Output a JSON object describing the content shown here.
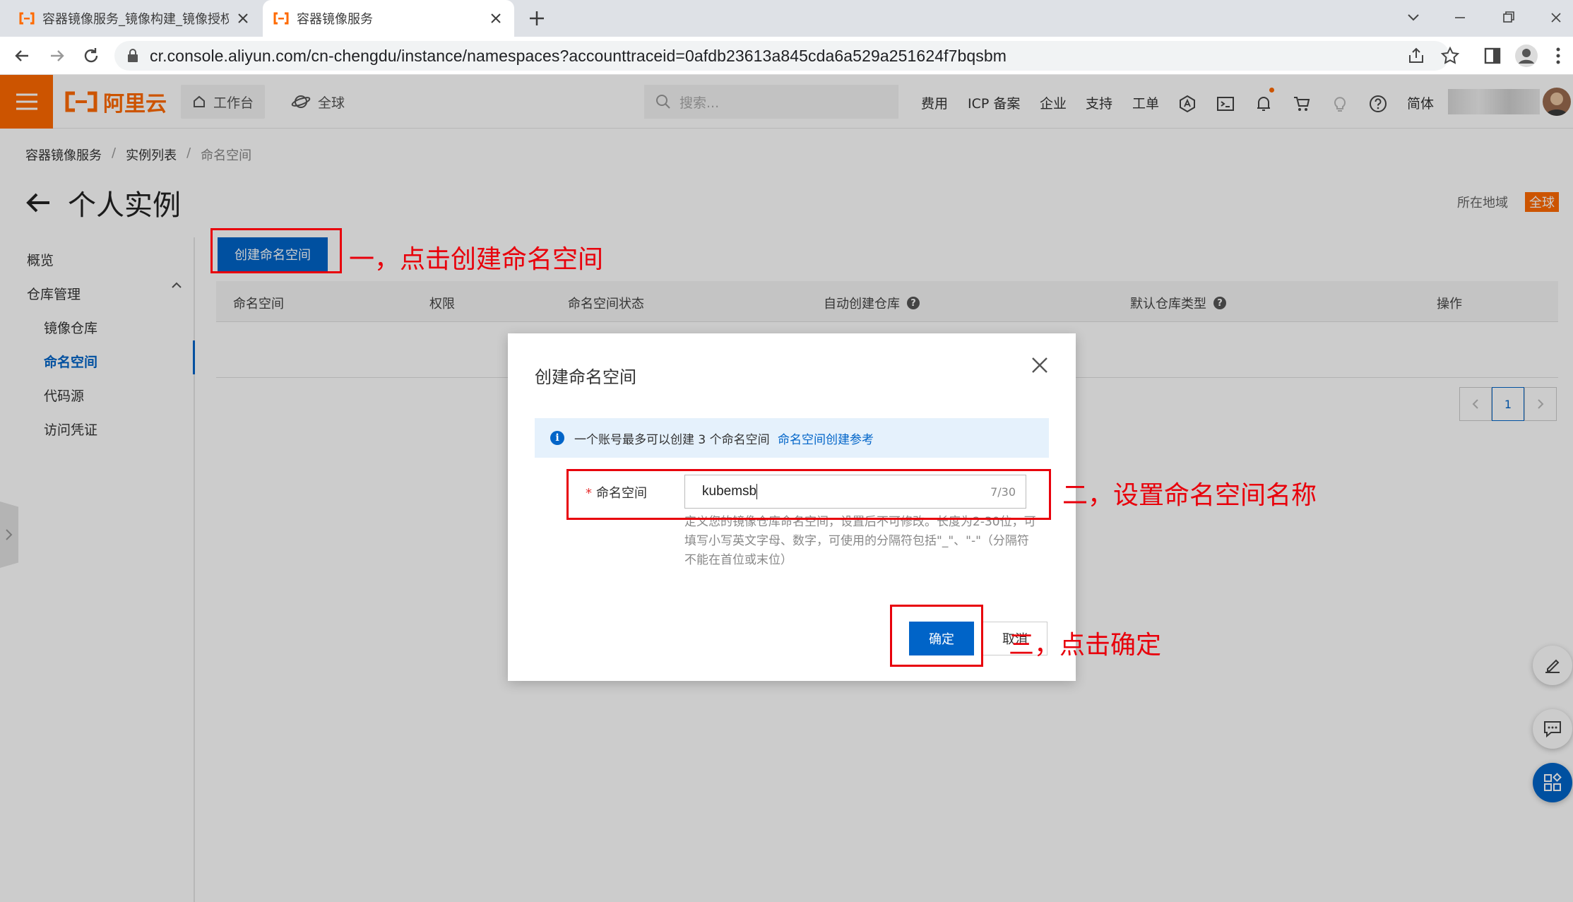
{
  "browser": {
    "tabs": [
      {
        "title": "容器镜像服务_镜像构建_镜像授权",
        "active": false
      },
      {
        "title": "容器镜像服务",
        "active": true
      }
    ],
    "url": "cr.console.aliyun.com/cn-chengdu/instance/namespaces?accounttraceid=0afdb23613a845cda6a529a251624f7bqsbm"
  },
  "topbar": {
    "logo": "阿里云",
    "workbench": "工作台",
    "global": "全球",
    "search_placeholder": "搜索...",
    "links": [
      "费用",
      "ICP 备案",
      "企业",
      "支持",
      "工单"
    ],
    "language": "简体"
  },
  "breadcrumb": [
    "容器镜像服务",
    "实例列表",
    "命名空间"
  ],
  "page_title": "个人实例",
  "region": {
    "label": "所在地域",
    "value": "全球"
  },
  "sidebar": {
    "overview": "概览",
    "repo_management": "仓库管理",
    "items": [
      "镜像仓库",
      "命名空间",
      "代码源",
      "访问凭证"
    ],
    "active": "命名空间"
  },
  "create_button": "创建命名空间",
  "table": {
    "columns": [
      "命名空间",
      "权限",
      "命名空间状态",
      "自动创建仓库",
      "默认仓库类型",
      "操作"
    ],
    "rows": []
  },
  "pagination": {
    "current": "1"
  },
  "dialog": {
    "title": "创建命名空间",
    "notice": "一个账号最多可以创建 3 个命名空间",
    "notice_link": "命名空间创建参考",
    "field_label": "命名空间",
    "field_value": "kubemsb",
    "field_count": "7/30",
    "help": "定义您的镜像仓库命名空间，设置后不可修改。长度为2-30位，可填写小写英文字母、数字，可使用的分隔符包括\"_\"、\"-\"（分隔符不能在首位或末位）",
    "ok": "确定",
    "cancel": "取消"
  },
  "annotations": {
    "step1": "一，点击创建命名空间",
    "step2": "二，设置命名空间名称",
    "step3": "三，点击确定"
  },
  "colors": {
    "brand": "#ff6a00",
    "primary": "#0064c8",
    "annotation": "#e8000b"
  }
}
